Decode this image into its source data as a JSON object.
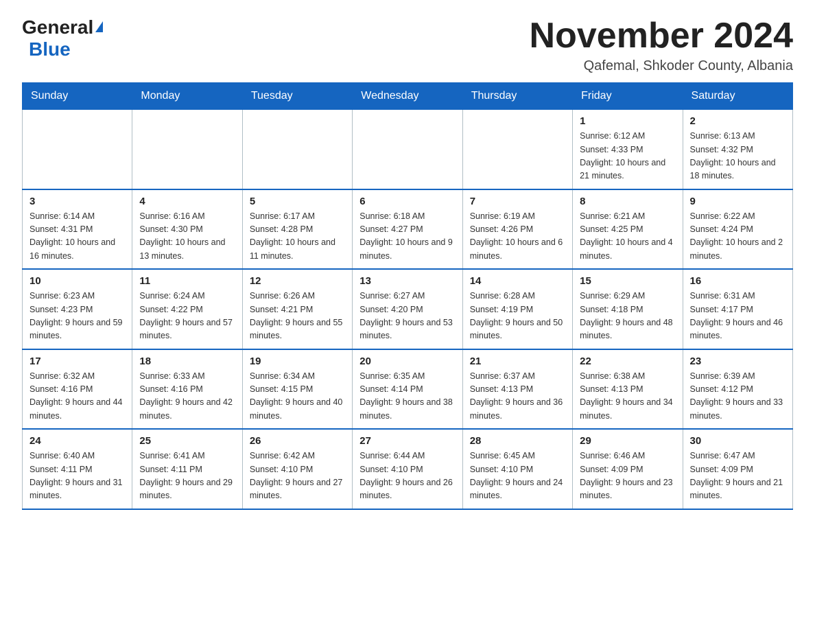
{
  "logo": {
    "general": "General",
    "triangle": "▲",
    "blue": "Blue"
  },
  "header": {
    "month_title": "November 2024",
    "subtitle": "Qafemal, Shkoder County, Albania"
  },
  "calendar": {
    "days_of_week": [
      "Sunday",
      "Monday",
      "Tuesday",
      "Wednesday",
      "Thursday",
      "Friday",
      "Saturday"
    ],
    "weeks": [
      [
        {
          "day": "",
          "sunrise": "",
          "sunset": "",
          "daylight": ""
        },
        {
          "day": "",
          "sunrise": "",
          "sunset": "",
          "daylight": ""
        },
        {
          "day": "",
          "sunrise": "",
          "sunset": "",
          "daylight": ""
        },
        {
          "day": "",
          "sunrise": "",
          "sunset": "",
          "daylight": ""
        },
        {
          "day": "",
          "sunrise": "",
          "sunset": "",
          "daylight": ""
        },
        {
          "day": "1",
          "sunrise": "Sunrise: 6:12 AM",
          "sunset": "Sunset: 4:33 PM",
          "daylight": "Daylight: 10 hours and 21 minutes."
        },
        {
          "day": "2",
          "sunrise": "Sunrise: 6:13 AM",
          "sunset": "Sunset: 4:32 PM",
          "daylight": "Daylight: 10 hours and 18 minutes."
        }
      ],
      [
        {
          "day": "3",
          "sunrise": "Sunrise: 6:14 AM",
          "sunset": "Sunset: 4:31 PM",
          "daylight": "Daylight: 10 hours and 16 minutes."
        },
        {
          "day": "4",
          "sunrise": "Sunrise: 6:16 AM",
          "sunset": "Sunset: 4:30 PM",
          "daylight": "Daylight: 10 hours and 13 minutes."
        },
        {
          "day": "5",
          "sunrise": "Sunrise: 6:17 AM",
          "sunset": "Sunset: 4:28 PM",
          "daylight": "Daylight: 10 hours and 11 minutes."
        },
        {
          "day": "6",
          "sunrise": "Sunrise: 6:18 AM",
          "sunset": "Sunset: 4:27 PM",
          "daylight": "Daylight: 10 hours and 9 minutes."
        },
        {
          "day": "7",
          "sunrise": "Sunrise: 6:19 AM",
          "sunset": "Sunset: 4:26 PM",
          "daylight": "Daylight: 10 hours and 6 minutes."
        },
        {
          "day": "8",
          "sunrise": "Sunrise: 6:21 AM",
          "sunset": "Sunset: 4:25 PM",
          "daylight": "Daylight: 10 hours and 4 minutes."
        },
        {
          "day": "9",
          "sunrise": "Sunrise: 6:22 AM",
          "sunset": "Sunset: 4:24 PM",
          "daylight": "Daylight: 10 hours and 2 minutes."
        }
      ],
      [
        {
          "day": "10",
          "sunrise": "Sunrise: 6:23 AM",
          "sunset": "Sunset: 4:23 PM",
          "daylight": "Daylight: 9 hours and 59 minutes."
        },
        {
          "day": "11",
          "sunrise": "Sunrise: 6:24 AM",
          "sunset": "Sunset: 4:22 PM",
          "daylight": "Daylight: 9 hours and 57 minutes."
        },
        {
          "day": "12",
          "sunrise": "Sunrise: 6:26 AM",
          "sunset": "Sunset: 4:21 PM",
          "daylight": "Daylight: 9 hours and 55 minutes."
        },
        {
          "day": "13",
          "sunrise": "Sunrise: 6:27 AM",
          "sunset": "Sunset: 4:20 PM",
          "daylight": "Daylight: 9 hours and 53 minutes."
        },
        {
          "day": "14",
          "sunrise": "Sunrise: 6:28 AM",
          "sunset": "Sunset: 4:19 PM",
          "daylight": "Daylight: 9 hours and 50 minutes."
        },
        {
          "day": "15",
          "sunrise": "Sunrise: 6:29 AM",
          "sunset": "Sunset: 4:18 PM",
          "daylight": "Daylight: 9 hours and 48 minutes."
        },
        {
          "day": "16",
          "sunrise": "Sunrise: 6:31 AM",
          "sunset": "Sunset: 4:17 PM",
          "daylight": "Daylight: 9 hours and 46 minutes."
        }
      ],
      [
        {
          "day": "17",
          "sunrise": "Sunrise: 6:32 AM",
          "sunset": "Sunset: 4:16 PM",
          "daylight": "Daylight: 9 hours and 44 minutes."
        },
        {
          "day": "18",
          "sunrise": "Sunrise: 6:33 AM",
          "sunset": "Sunset: 4:16 PM",
          "daylight": "Daylight: 9 hours and 42 minutes."
        },
        {
          "day": "19",
          "sunrise": "Sunrise: 6:34 AM",
          "sunset": "Sunset: 4:15 PM",
          "daylight": "Daylight: 9 hours and 40 minutes."
        },
        {
          "day": "20",
          "sunrise": "Sunrise: 6:35 AM",
          "sunset": "Sunset: 4:14 PM",
          "daylight": "Daylight: 9 hours and 38 minutes."
        },
        {
          "day": "21",
          "sunrise": "Sunrise: 6:37 AM",
          "sunset": "Sunset: 4:13 PM",
          "daylight": "Daylight: 9 hours and 36 minutes."
        },
        {
          "day": "22",
          "sunrise": "Sunrise: 6:38 AM",
          "sunset": "Sunset: 4:13 PM",
          "daylight": "Daylight: 9 hours and 34 minutes."
        },
        {
          "day": "23",
          "sunrise": "Sunrise: 6:39 AM",
          "sunset": "Sunset: 4:12 PM",
          "daylight": "Daylight: 9 hours and 33 minutes."
        }
      ],
      [
        {
          "day": "24",
          "sunrise": "Sunrise: 6:40 AM",
          "sunset": "Sunset: 4:11 PM",
          "daylight": "Daylight: 9 hours and 31 minutes."
        },
        {
          "day": "25",
          "sunrise": "Sunrise: 6:41 AM",
          "sunset": "Sunset: 4:11 PM",
          "daylight": "Daylight: 9 hours and 29 minutes."
        },
        {
          "day": "26",
          "sunrise": "Sunrise: 6:42 AM",
          "sunset": "Sunset: 4:10 PM",
          "daylight": "Daylight: 9 hours and 27 minutes."
        },
        {
          "day": "27",
          "sunrise": "Sunrise: 6:44 AM",
          "sunset": "Sunset: 4:10 PM",
          "daylight": "Daylight: 9 hours and 26 minutes."
        },
        {
          "day": "28",
          "sunrise": "Sunrise: 6:45 AM",
          "sunset": "Sunset: 4:10 PM",
          "daylight": "Daylight: 9 hours and 24 minutes."
        },
        {
          "day": "29",
          "sunrise": "Sunrise: 6:46 AM",
          "sunset": "Sunset: 4:09 PM",
          "daylight": "Daylight: 9 hours and 23 minutes."
        },
        {
          "day": "30",
          "sunrise": "Sunrise: 6:47 AM",
          "sunset": "Sunset: 4:09 PM",
          "daylight": "Daylight: 9 hours and 21 minutes."
        }
      ]
    ]
  }
}
